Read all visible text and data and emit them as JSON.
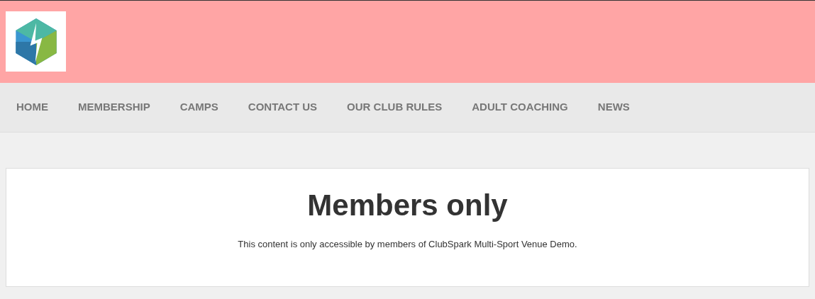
{
  "nav": [
    {
      "label": "HOME"
    },
    {
      "label": "MEMBERSHIP"
    },
    {
      "label": "CAMPS"
    },
    {
      "label": "CONTACT US"
    },
    {
      "label": "OUR CLUB RULES"
    },
    {
      "label": "ADULT COACHING"
    },
    {
      "label": "NEWS"
    }
  ],
  "card": {
    "title": "Members only",
    "message": "This content is only accessible by members of ClubSpark Multi-Sport Venue Demo."
  }
}
